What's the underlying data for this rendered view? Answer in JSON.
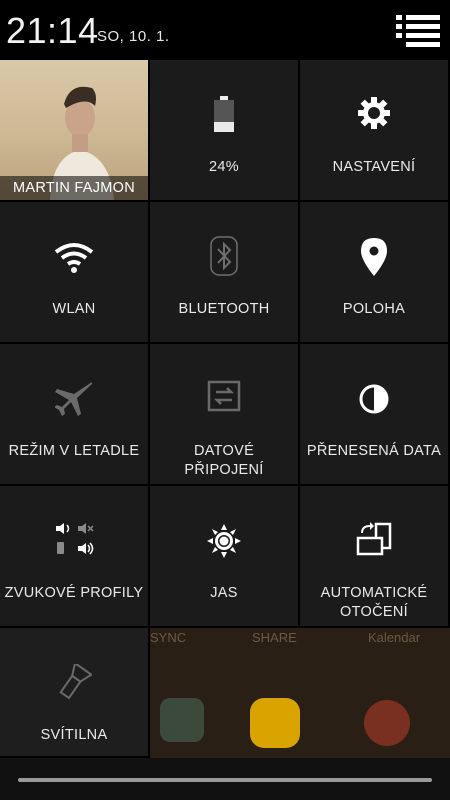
{
  "status": {
    "time": "21:14",
    "date": "SO, 10. 1."
  },
  "profile": {
    "name": "MARTIN FAJMON"
  },
  "tiles": [
    {
      "label": "24%",
      "icon": "battery-icon"
    },
    {
      "label": "NASTAVENÍ",
      "icon": "gear-icon"
    },
    {
      "label": "WLAN",
      "icon": "wifi-icon"
    },
    {
      "label": "BLUETOOTH",
      "icon": "bluetooth-icon"
    },
    {
      "label": "POLOHA",
      "icon": "location-pin-icon"
    },
    {
      "label": "REŽIM V LETADLE",
      "icon": "airplane-icon"
    },
    {
      "label_line1": "DATOVÉ",
      "label_line2": "PŘIPOJENÍ",
      "icon": "mobile-data-icon"
    },
    {
      "label": "PŘENESENÁ DATA",
      "icon": "data-usage-icon"
    },
    {
      "label": "ZVUKOVÉ PROFILY",
      "icon": "sound-profiles-icon"
    },
    {
      "label": "JAS",
      "icon": "brightness-icon"
    },
    {
      "label_line1": "AUTOMATICKÉ",
      "label_line2": "OTOČENÍ",
      "icon": "auto-rotate-icon"
    },
    {
      "label": "SVÍTILNA",
      "icon": "flashlight-icon"
    }
  ],
  "wallpaper": {
    "text1": "SYNC",
    "text2": "SHARE",
    "text3": "Kalendar"
  },
  "colors": {
    "tile_bg": "#1b1b1b",
    "active": "#ffffff",
    "inactive": "#8a8a8a"
  }
}
